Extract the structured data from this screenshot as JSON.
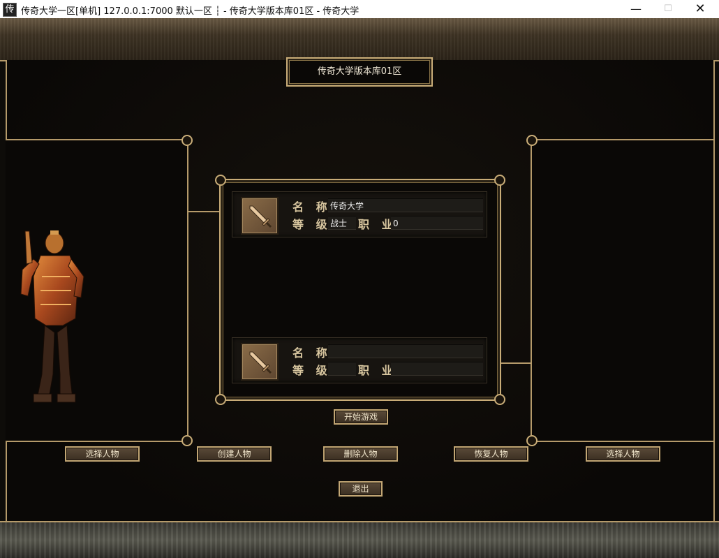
{
  "window": {
    "title": "传奇大学一区[单机] 127.0.0.1:7000  默认一区 ┆ - 传奇大学版本库01区 - 传奇大学",
    "app_icon": "传",
    "minimize": "—",
    "maximize": "☐",
    "close": "✕"
  },
  "server": {
    "name": "传奇大学版本库01区"
  },
  "slots": [
    {
      "name_label": "名 称",
      "level_label": "等 级",
      "job_label": "职 业",
      "name_value": "传奇大学",
      "job_value": "战士",
      "level_value": "0",
      "icon": "sword-icon"
    },
    {
      "name_label": "名 称",
      "level_label": "等 级",
      "job_label": "职 业",
      "name_value": "",
      "job_value": "",
      "level_value": "",
      "icon": "sword-icon"
    }
  ],
  "buttons": {
    "start": "开始游戏",
    "select_left": "选择人物",
    "create": "创建人物",
    "delete": "删除人物",
    "restore": "恢复人物",
    "select_right": "选择人物",
    "exit": "退出"
  },
  "colors": {
    "gold_border": "#c9ad78",
    "button_text": "#f1e6cc",
    "label": "#d9c7a0"
  }
}
